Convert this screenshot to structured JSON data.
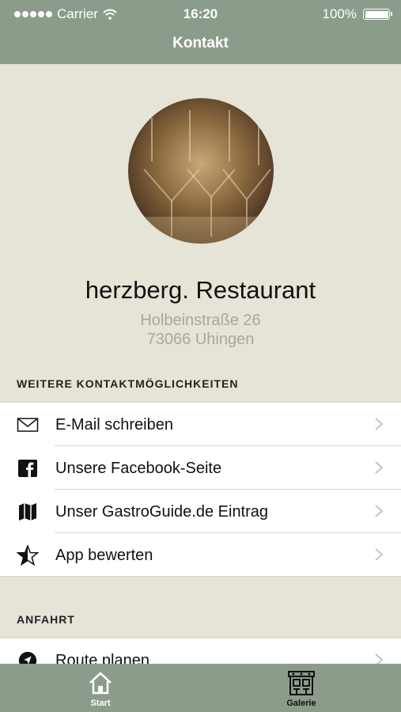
{
  "status_bar": {
    "carrier": "Carrier",
    "time": "16:20",
    "battery": "100%"
  },
  "header": {
    "title": "Kontakt"
  },
  "profile": {
    "name": "herzberg. Restaurant",
    "street": "Holbeinstraße 26",
    "city": "73066 Uhingen"
  },
  "contact_section": {
    "title": "WEITERE KONTAKTMÖGLICHKEITEN",
    "items": [
      {
        "label": "E-Mail schreiben",
        "icon": "mail-icon"
      },
      {
        "label": "Unsere Facebook-Seite",
        "icon": "facebook-icon"
      },
      {
        "label": "Unser GastroGuide.de Eintrag",
        "icon": "map-icon"
      },
      {
        "label": "App bewerten",
        "icon": "star-icon"
      }
    ]
  },
  "directions_section": {
    "title": "ANFAHRT",
    "items": [
      {
        "label": "Route planen",
        "icon": "navigation-icon"
      }
    ]
  },
  "tabbar": {
    "tabs": [
      {
        "label": "Start",
        "icon": "home-icon"
      },
      {
        "label": "Galerie",
        "icon": "gallery-icon"
      }
    ]
  },
  "colors": {
    "header": "#8c9c8a",
    "background": "#e6e3d7",
    "address": "#a7a7a2"
  }
}
